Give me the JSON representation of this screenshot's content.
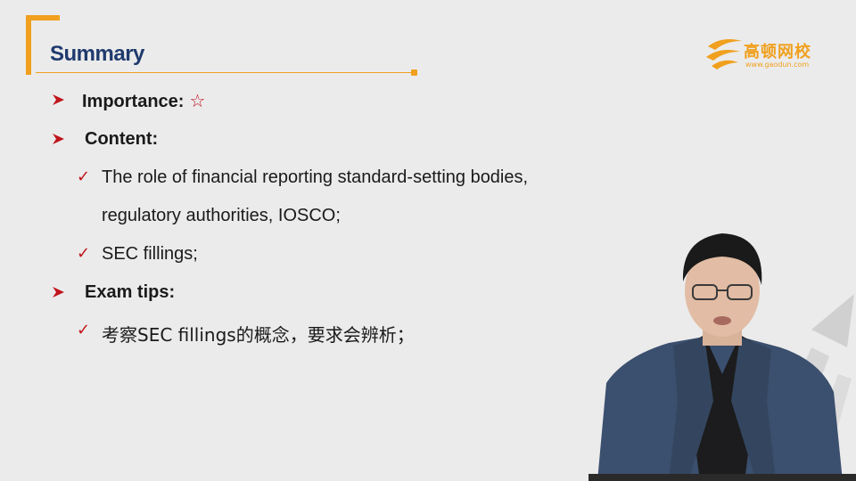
{
  "slide": {
    "title": "Summary",
    "logo": {
      "name": "高顿网校",
      "url": "www.gaodun.com"
    },
    "bullets": [
      {
        "label": "Importance:",
        "star": "☆"
      },
      {
        "label": "Content:"
      },
      {
        "text": "The role of financial reporting standard-setting bodies,"
      },
      {
        "text": "regulatory authorities, IOSCO;"
      },
      {
        "text": "SEC fillings;"
      },
      {
        "label": "Exam tips:"
      },
      {
        "text": "考察SEC fillings的概念，要求会辨析；"
      }
    ],
    "check_glyph": "✓"
  },
  "colors": {
    "accent": "#f0a01e",
    "title": "#1f3a6e",
    "bullet": "#c0141c",
    "background": "#ebebeb"
  },
  "icons": {
    "level1": "arrow-bullet-icon",
    "level2": "checkmark-icon",
    "importance": "star-icon"
  }
}
